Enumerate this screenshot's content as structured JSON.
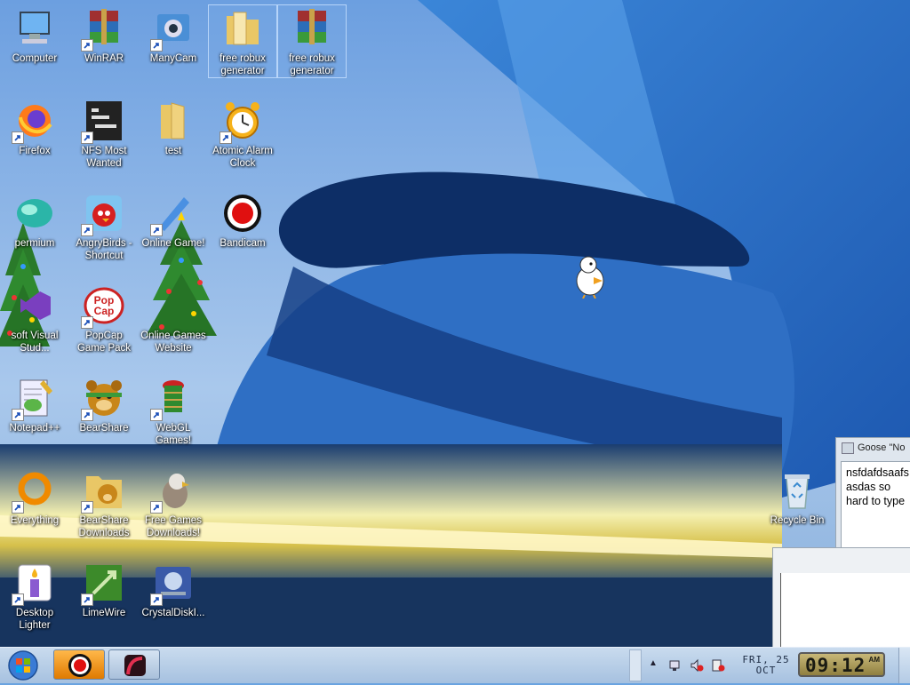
{
  "desktop": {
    "icons": [
      {
        "label": "Computer",
        "icon": "computer-icon"
      },
      {
        "label": "WinRAR",
        "icon": "winrar-icon"
      },
      {
        "label": "ManyCam",
        "icon": "manycam-icon"
      },
      {
        "label": "free robux generator",
        "icon": "folder-icon"
      },
      {
        "label": "free robux generator",
        "icon": "winrar-archive-icon"
      },
      {
        "label": "Firefox",
        "icon": "firefox-icon"
      },
      {
        "label": "NFS Most Wanted",
        "icon": "nfs-icon"
      },
      {
        "label": "test",
        "icon": "folder-icon"
      },
      {
        "label": "Atomic Alarm Clock",
        "icon": "alarm-clock-icon"
      },
      {
        "label": "permium",
        "icon": "permium-icon"
      },
      {
        "label": "AngryBirds - Shortcut",
        "icon": "angry-birds-icon"
      },
      {
        "label": "Online Game!",
        "icon": "online-game-icon"
      },
      {
        "label": "Bandicam",
        "icon": "bandicam-icon"
      },
      {
        "label": "soft Visual Stud...",
        "icon": "visual-studio-icon"
      },
      {
        "label": "PopCap Game Pack",
        "icon": "popcap-icon"
      },
      {
        "label": "Online Games Website",
        "icon": "online-games-icon"
      },
      {
        "label": "Notepad++",
        "icon": "notepadpp-icon"
      },
      {
        "label": "BearShare",
        "icon": "bearshare-icon"
      },
      {
        "label": "WebGL Games!",
        "icon": "webgl-icon"
      },
      {
        "label": "Everything",
        "icon": "everything-icon"
      },
      {
        "label": "BearShare Downloads",
        "icon": "bearshare-folder-icon"
      },
      {
        "label": "Free Games Downloads!",
        "icon": "eagle-icon"
      },
      {
        "label": "Desktop Lighter",
        "icon": "candle-icon"
      },
      {
        "label": "LimeWire",
        "icon": "limewire-icon"
      },
      {
        "label": "CrystalDiskI...",
        "icon": "crystaldisk-icon"
      },
      {
        "label": "Recycle Bin",
        "icon": "recycle-bin-icon"
      }
    ]
  },
  "goose_note": {
    "title": "Goose \"No",
    "text": "nsfdafdsaafs asdas so hard to type"
  },
  "taskbar": {
    "date_day": "FRI, 25",
    "date_month": "OCT",
    "time": "09:12",
    "ampm": "AM"
  },
  "colors": {
    "wall_sky": "#7fb3e8",
    "wall_blue": "#2f6fc4",
    "wall_dark": "#0d2e66",
    "taskbar": "#b7cde6"
  }
}
